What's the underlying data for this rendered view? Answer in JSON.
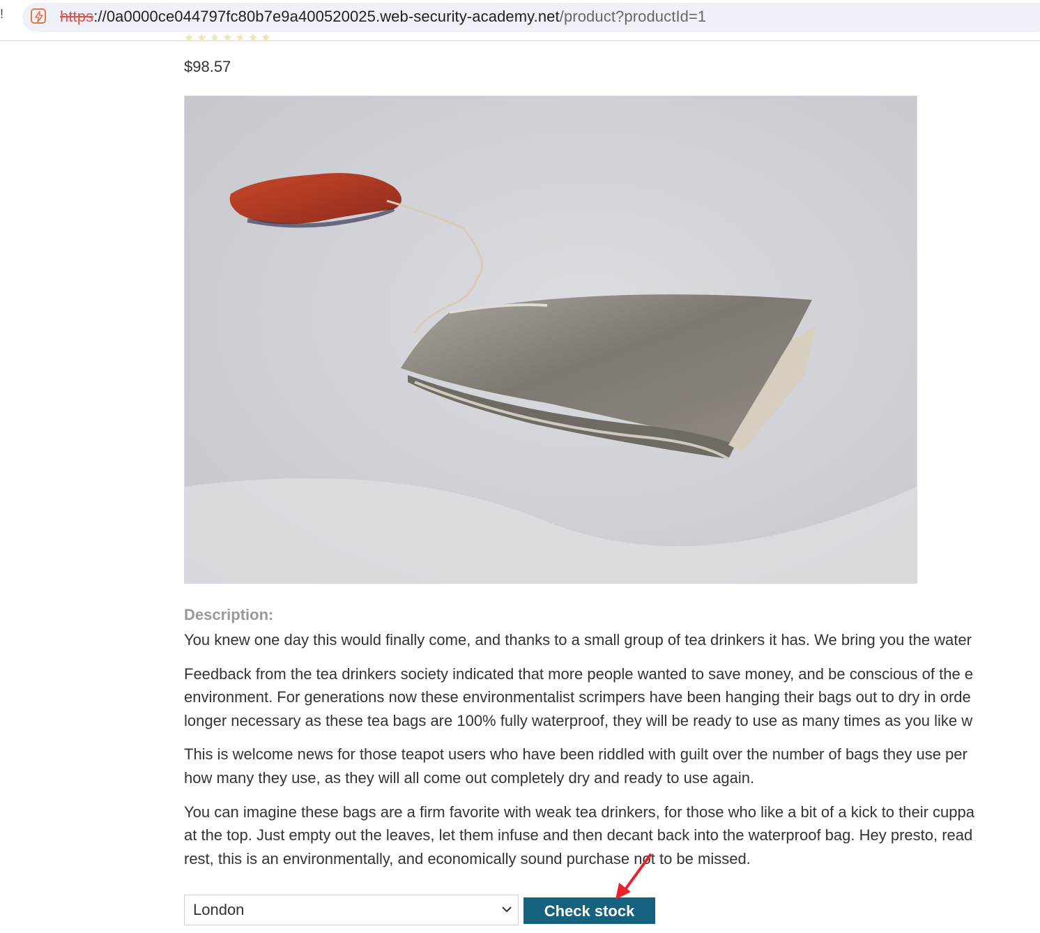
{
  "browser": {
    "url_scheme": "https",
    "url_host": "://0a0000ce044797fc80b7e9a400520025.web-security-academy.net",
    "url_path": "/product?productId=1"
  },
  "product": {
    "rating_stars": "★★★★★★★",
    "price": "$98.57",
    "image_icon": "tea-bag-photo"
  },
  "description": {
    "title": "Description:",
    "paragraphs": [
      "You knew one day this would finally come, and thanks to a small group of tea drinkers it has. We bring you the water",
      "Feedback from the tea drinkers society indicated that more people wanted to save money, and be conscious of the e",
      "environment. For generations now these environmentalist scrimpers have been hanging their bags out to dry in orde",
      "longer necessary as these tea bags are 100% fully waterproof, they will be ready to use as many times as you like w",
      "This is welcome news for those teapot users who have been riddled with guilt over the number of bags they use per",
      "how many they use, as they will all come out completely dry and ready to use again.",
      "You can imagine these bags are a firm favorite with weak tea drinkers, for those who like a bit of a kick to their cuppa",
      "at the top. Just empty out the leaves, let them infuse and then decant back into the waterproof bag. Hey presto, read",
      "rest, this is an environmentally, and economically sound purchase not to be missed."
    ]
  },
  "stock": {
    "selected_store": "London",
    "button_label": "Check stock"
  },
  "colors": {
    "button_bg": "#15627e",
    "annotation_arrow": "#e8232a",
    "description_title": "#999999"
  }
}
